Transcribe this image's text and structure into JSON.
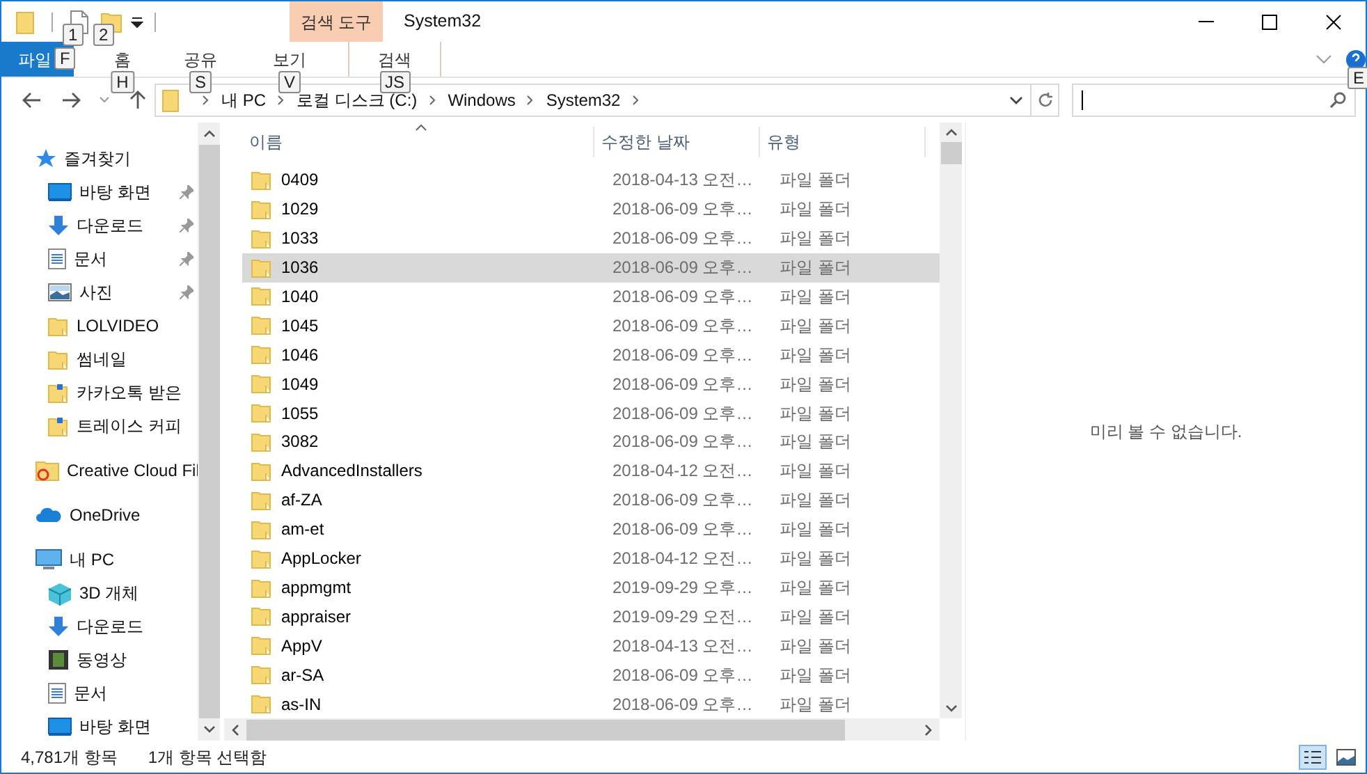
{
  "quick_access": {
    "keytips": [
      "1",
      "2"
    ]
  },
  "window": {
    "title": "System32",
    "context_tab": "검색 도구"
  },
  "ribbon": {
    "file_tab": {
      "label": "파일",
      "keytip": "F"
    },
    "tabs": [
      {
        "label": "홈",
        "keytip": "H",
        "kind": "plain"
      },
      {
        "label": "공유",
        "keytip": "S",
        "kind": "plain"
      },
      {
        "label": "보기",
        "keytip": "V",
        "kind": "plain"
      },
      {
        "label": "검색",
        "keytip": "JS",
        "kind": "context"
      }
    ],
    "help_keytip": "E"
  },
  "address": {
    "crumbs": [
      "내 PC",
      "로컬 디스크 (C:)",
      "Windows",
      "System32"
    ]
  },
  "nav": [
    {
      "label": "즐겨찾기",
      "kind": "favorites",
      "children": [
        {
          "label": "바탕 화면",
          "kind": "desktop",
          "pinned": true
        },
        {
          "label": "다운로드",
          "kind": "download",
          "pinned": true
        },
        {
          "label": "문서",
          "kind": "document",
          "pinned": true
        },
        {
          "label": "사진",
          "kind": "pictures",
          "pinned": true
        },
        {
          "label": "LOLVIDEO",
          "kind": "folder",
          "pinned": false
        },
        {
          "label": "썸네일",
          "kind": "folder",
          "pinned": false
        },
        {
          "label": "카카오톡 받은",
          "kind": "shortcut",
          "pinned": false
        },
        {
          "label": "트레이스 커피",
          "kind": "shortcut",
          "pinned": false
        }
      ]
    },
    {
      "label": "Creative Cloud Fil",
      "kind": "cloudfiles"
    },
    {
      "label": "OneDrive",
      "kind": "onedrive"
    },
    {
      "label": "내 PC",
      "kind": "pc",
      "children": [
        {
          "label": "3D 개체",
          "kind": "objects",
          "pinned": false
        },
        {
          "label": "다운로드",
          "kind": "download",
          "pinned": false
        },
        {
          "label": "동영상",
          "kind": "video",
          "pinned": false
        },
        {
          "label": "문서",
          "kind": "document",
          "pinned": false
        },
        {
          "label": "바탕 화면",
          "kind": "desktop",
          "pinned": false
        }
      ]
    }
  ],
  "table": {
    "columns": [
      "이름",
      "수정한 날짜",
      "유형"
    ],
    "rows": [
      {
        "name": "0409",
        "date": "2018-04-13 오전…",
        "type": "파일 폴더",
        "selected": false
      },
      {
        "name": "1029",
        "date": "2018-06-09 오후…",
        "type": "파일 폴더",
        "selected": false
      },
      {
        "name": "1033",
        "date": "2018-06-09 오후…",
        "type": "파일 폴더",
        "selected": false
      },
      {
        "name": "1036",
        "date": "2018-06-09 오후…",
        "type": "파일 폴더",
        "selected": true
      },
      {
        "name": "1040",
        "date": "2018-06-09 오후…",
        "type": "파일 폴더",
        "selected": false
      },
      {
        "name": "1045",
        "date": "2018-06-09 오후…",
        "type": "파일 폴더",
        "selected": false
      },
      {
        "name": "1046",
        "date": "2018-06-09 오후…",
        "type": "파일 폴더",
        "selected": false
      },
      {
        "name": "1049",
        "date": "2018-06-09 오후…",
        "type": "파일 폴더",
        "selected": false
      },
      {
        "name": "1055",
        "date": "2018-06-09 오후…",
        "type": "파일 폴더",
        "selected": false
      },
      {
        "name": "3082",
        "date": "2018-06-09 오후…",
        "type": "파일 폴더",
        "selected": false
      },
      {
        "name": "AdvancedInstallers",
        "date": "2018-04-12 오전…",
        "type": "파일 폴더",
        "selected": false
      },
      {
        "name": "af-ZA",
        "date": "2018-06-09 오후…",
        "type": "파일 폴더",
        "selected": false
      },
      {
        "name": "am-et",
        "date": "2018-06-09 오후…",
        "type": "파일 폴더",
        "selected": false
      },
      {
        "name": "AppLocker",
        "date": "2018-04-12 오전…",
        "type": "파일 폴더",
        "selected": false
      },
      {
        "name": "appmgmt",
        "date": "2019-09-29 오후…",
        "type": "파일 폴더",
        "selected": false
      },
      {
        "name": "appraiser",
        "date": "2019-09-29 오전…",
        "type": "파일 폴더",
        "selected": false
      },
      {
        "name": "AppV",
        "date": "2018-04-13 오전…",
        "type": "파일 폴더",
        "selected": false
      },
      {
        "name": "ar-SA",
        "date": "2018-06-09 오후…",
        "type": "파일 폴더",
        "selected": false
      },
      {
        "name": "as-IN",
        "date": "2018-06-09 오후…",
        "type": "파일 폴더",
        "selected": false
      }
    ]
  },
  "preview": {
    "message": "미리 볼 수 없습니다."
  },
  "status_bar": {
    "count": "4,781개 항목",
    "selection": "1개 항목 선택함"
  }
}
